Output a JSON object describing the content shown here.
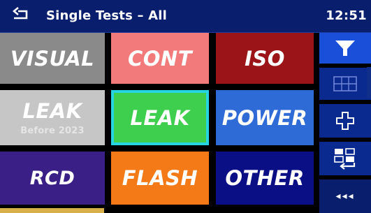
{
  "header": {
    "title": "Single Tests – All",
    "time": "12:51"
  },
  "tiles": [
    {
      "label": "VISUAL",
      "sub": "",
      "color": "#8a8a8a"
    },
    {
      "label": "CONT",
      "sub": "",
      "color": "#f27a7a"
    },
    {
      "label": "ISO",
      "sub": "",
      "color": "#9b1518"
    },
    {
      "label": "LEAK",
      "sub": "Before 2023",
      "color": "#c6c6c6"
    },
    {
      "label": "LEAK",
      "sub": "",
      "color": "#3fcf4f",
      "selected": true
    },
    {
      "label": "POWER",
      "sub": "",
      "color": "#2f6bd6"
    },
    {
      "label": "RCD",
      "sub": "",
      "color": "#3a1f86"
    },
    {
      "label": "FLASH",
      "sub": "",
      "color": "#f47a18"
    },
    {
      "label": "OTHER",
      "sub": "",
      "color": "#0a0f86"
    }
  ],
  "sidebar": {
    "icons": [
      "filter-icon",
      "grid-view-icon",
      "move-icon",
      "reorder-icon"
    ],
    "more_label": "◂◂◂"
  },
  "colors": {
    "header_bg": "#0a1e6e",
    "accent": "#25d6e2",
    "sidebar_bg": "#0b2a90"
  }
}
